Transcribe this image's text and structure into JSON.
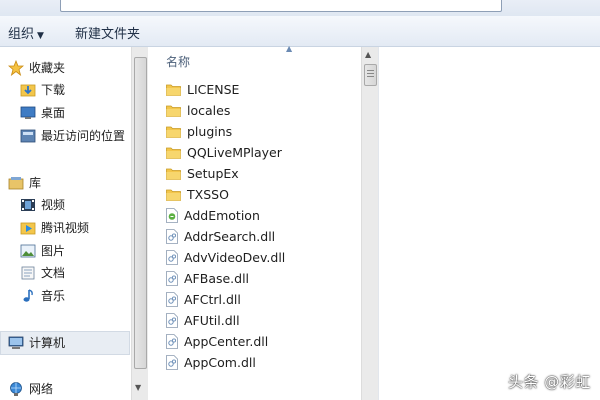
{
  "toolbar": {
    "organize_label": "组织",
    "new_folder_label": "新建文件夹"
  },
  "nav": {
    "favorites": {
      "label": "收藏夹",
      "items": [
        "下载",
        "桌面",
        "最近访问的位置"
      ]
    },
    "libraries": {
      "label": "库",
      "items": [
        "视频",
        "腾讯视频",
        "图片",
        "文档",
        "音乐"
      ]
    },
    "computer": "计算机",
    "network": "网络"
  },
  "filelist": {
    "column_name": "名称",
    "folders": [
      "LICENSE",
      "locales",
      "plugins",
      "QQLiveMPlayer",
      "SetupEx",
      "TXSSO"
    ],
    "files": [
      "AddEmotion",
      "AddrSearch.dll",
      "AdvVideoDev.dll",
      "AFBase.dll",
      "AFCtrl.dll",
      "AFUtil.dll",
      "AppCenter.dll",
      "AppCom.dll"
    ]
  },
  "watermark": "头条 @彩虹",
  "colors": {
    "folder": "#f3c64b",
    "selection": "#e8edf3",
    "command_bar": "#e3eaf4"
  },
  "icons": {
    "favorites": "star-icon",
    "download": "download-folder-icon",
    "desktop": "desktop-icon",
    "recent": "recent-places-icon",
    "library": "library-icon",
    "video": "video-icon",
    "tencent_video": "tencent-video-icon",
    "pictures": "pictures-icon",
    "documents": "documents-icon",
    "music": "music-note-icon",
    "computer": "computer-icon",
    "network": "network-icon",
    "folder": "folder-icon",
    "dll": "dll-file-icon",
    "exe": "exe-file-icon"
  }
}
